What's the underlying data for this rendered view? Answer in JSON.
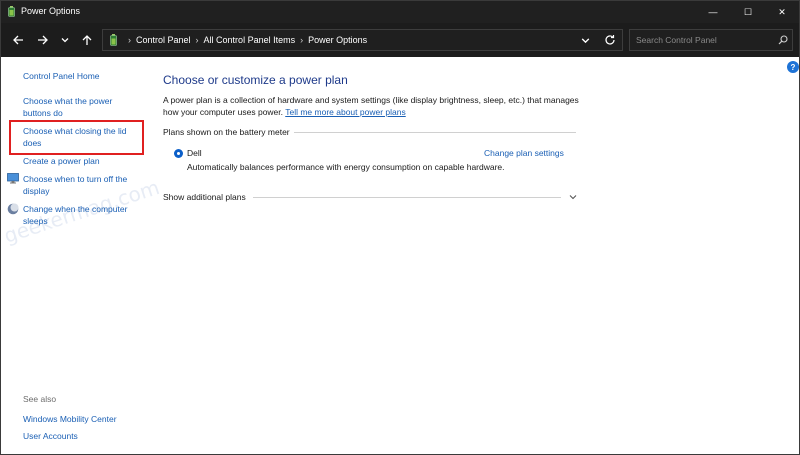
{
  "window": {
    "title": "Power Options",
    "controls": {
      "minimize": "—",
      "maximize": "☐",
      "close": "✕"
    }
  },
  "nav": {
    "breadcrumbs": [
      "Control Panel",
      "All Control Panel Items",
      "Power Options"
    ],
    "search_placeholder": "Search Control Panel"
  },
  "sidebar": {
    "home": "Control Panel Home",
    "links": [
      "Choose what the power buttons do",
      "Choose what closing the lid does",
      "Create a power plan",
      "Choose when to turn off the display",
      "Change when the computer sleeps"
    ],
    "see_also_label": "See also",
    "see_also": [
      "Windows Mobility Center",
      "User Accounts"
    ]
  },
  "main": {
    "heading": "Choose or customize a power plan",
    "description": "A power plan is a collection of hardware and system settings (like display brightness, sleep, etc.) that manages how your computer uses power.",
    "description_link": "Tell me more about power plans",
    "group_label": "Plans shown on the battery meter",
    "plan": {
      "name": "Dell",
      "selected": true,
      "change_link": "Change plan settings",
      "description": "Automatically balances performance with energy consumption on capable hardware."
    },
    "show_additional": "Show additional plans"
  },
  "help_button": "?",
  "watermark_text": "geekermag.com",
  "colors": {
    "accent": "#1a5fb4",
    "heading": "#1e3a8a",
    "highlight": "#e02020",
    "titlebar": "#202020"
  }
}
